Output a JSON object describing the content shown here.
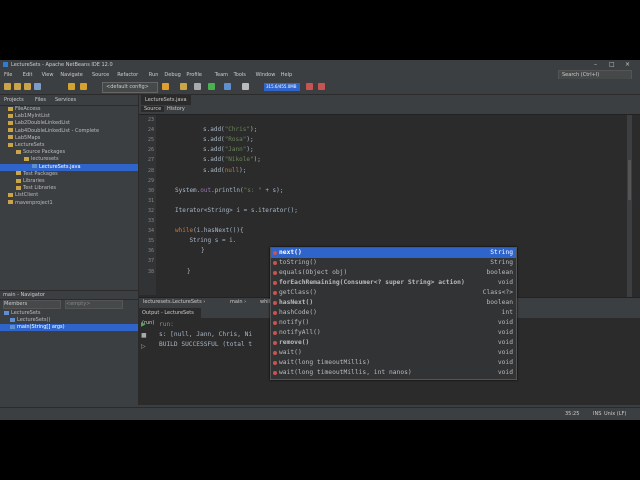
{
  "window": {
    "title": "LectureSets - Apache NetBeans IDE 12.0"
  },
  "menu": [
    "File",
    "Edit",
    "View",
    "Navigate",
    "Source",
    "Refactor",
    "Run",
    "Debug",
    "Profile",
    "Team",
    "Tools",
    "Window",
    "Help"
  ],
  "search": {
    "label": "Search (Ctrl+I)"
  },
  "toolbar": {
    "config": "<default config>",
    "memory": "315.6/455.0MB"
  },
  "panel_tabs": [
    "Projects",
    "Files",
    "Services"
  ],
  "tree": [
    {
      "label": "FileAccess",
      "indent": 8
    },
    {
      "label": "Lab1MyIntList",
      "indent": 8
    },
    {
      "label": "Lab2DoubleLinkedList",
      "indent": 8
    },
    {
      "label": "Lab4DoubleLinkedList - Complete",
      "indent": 8
    },
    {
      "label": "Lab5Maps",
      "indent": 8
    },
    {
      "label": "LectureSets",
      "indent": 8
    },
    {
      "label": "Source Packages",
      "indent": 16
    },
    {
      "label": "lecturesets",
      "indent": 24
    },
    {
      "label": "LectureSets.java",
      "indent": 32,
      "selected": true,
      "java": true
    },
    {
      "label": "Test Packages",
      "indent": 16
    },
    {
      "label": "Libraries",
      "indent": 16
    },
    {
      "label": "Test Libraries",
      "indent": 16
    },
    {
      "label": "ListClient",
      "indent": 8
    },
    {
      "label": "mavenproject1",
      "indent": 8
    }
  ],
  "navigator": {
    "title": "main - Navigator",
    "filter": "Members",
    "filter2": "<empty>",
    "items": [
      {
        "label": "LectureSets",
        "indent": 4
      },
      {
        "label": "LectureSets()",
        "indent": 10
      },
      {
        "label": "main(String[] args)",
        "indent": 10,
        "selected": true
      }
    ]
  },
  "editor": {
    "tab": "LectureSets.java",
    "source_label": "Source",
    "history_label": "History",
    "lines": [
      {
        "n": "23",
        "code": "",
        "parts": []
      },
      {
        "n": "24",
        "parts": [
          [
            "s.add(",
            ""
          ],
          [
            "\"Chris\"",
            "str"
          ],
          [
            ");",
            ""
          ]
        ]
      },
      {
        "n": "25",
        "parts": [
          [
            "s.add(",
            ""
          ],
          [
            "\"Rosa\"",
            "str"
          ],
          [
            ");",
            ""
          ]
        ]
      },
      {
        "n": "26",
        "parts": [
          [
            "s.add(",
            ""
          ],
          [
            "\"Jann\"",
            "str"
          ],
          [
            ");",
            ""
          ]
        ]
      },
      {
        "n": "27",
        "parts": [
          [
            "s.add(",
            ""
          ],
          [
            "\"Nikole\"",
            "str"
          ],
          [
            ");",
            ""
          ]
        ]
      },
      {
        "n": "28",
        "parts": [
          [
            "s.add(",
            ""
          ],
          [
            "null",
            "kw"
          ],
          [
            ");",
            ""
          ]
        ]
      },
      {
        "n": "29",
        "parts": []
      },
      {
        "n": "30",
        "parts": [
          [
            "System.",
            ""
          ],
          [
            "out",
            "fld"
          ],
          [
            ".println(",
            ""
          ],
          [
            "\"s: \"",
            "str"
          ],
          [
            " + s);",
            ""
          ]
        ]
      },
      {
        "n": "31",
        "parts": []
      },
      {
        "n": "32",
        "parts": [
          [
            "Iterator<String> i = s.iterator();",
            ""
          ]
        ]
      },
      {
        "n": "33",
        "parts": []
      },
      {
        "n": "34",
        "parts": [
          [
            "while",
            "kw"
          ],
          [
            "(i.hasNext()){",
            ""
          ]
        ]
      },
      {
        "n": "35",
        "parts": [
          [
            "    String s = i.",
            ""
          ]
        ]
      },
      {
        "n": "36",
        "parts": [
          [
            "}",
            ""
          ]
        ]
      },
      {
        "n": "37",
        "parts": []
      },
      {
        "n": "38",
        "parts": [
          [
            "}",
            ""
          ]
        ]
      }
    ]
  },
  "breadcrumb": [
    "lecturesets.LectureSets",
    "main",
    "while (i.hasNext())"
  ],
  "output": {
    "tab": "Output - LectureSets (run)",
    "lines": [
      {
        "text": "run:",
        "color": "#888888"
      },
      {
        "text": "s: [null, Jann, Chris, Ni",
        "color": "#a9b7c6"
      },
      {
        "text": "BUILD SUCCESSFUL (total t",
        "color": "#a9b7c6"
      }
    ]
  },
  "autocomplete": [
    {
      "name": "next()",
      "type": "String",
      "selected": true,
      "bold": true
    },
    {
      "name": "toString()",
      "type": "String"
    },
    {
      "name": "equals(Object obj)",
      "type": "boolean"
    },
    {
      "name": "forEachRemaining(Consumer<? super String> action)",
      "type": "void",
      "bold": true
    },
    {
      "name": "getClass()",
      "type": "Class<?>"
    },
    {
      "name": "hasNext()",
      "type": "boolean",
      "bold": true
    },
    {
      "name": "hashCode()",
      "type": "int"
    },
    {
      "name": "notify()",
      "type": "void"
    },
    {
      "name": "notifyAll()",
      "type": "void"
    },
    {
      "name": "remove()",
      "type": "void",
      "bold": true
    },
    {
      "name": "wait()",
      "type": "void"
    },
    {
      "name": "wait(long timeoutMillis)",
      "type": "void"
    },
    {
      "name": "wait(long timeoutMillis, int nanos)",
      "type": "void"
    }
  ],
  "status": {
    "position": "35:25",
    "mode": "INS",
    "encoding": "Unix (LF)"
  },
  "colors": {
    "ide_bg": "#3c3f41",
    "editor_bg": "#2b2b2b",
    "selection": "#2f65ca",
    "string": "#6a8759",
    "keyword": "#cc7832"
  }
}
